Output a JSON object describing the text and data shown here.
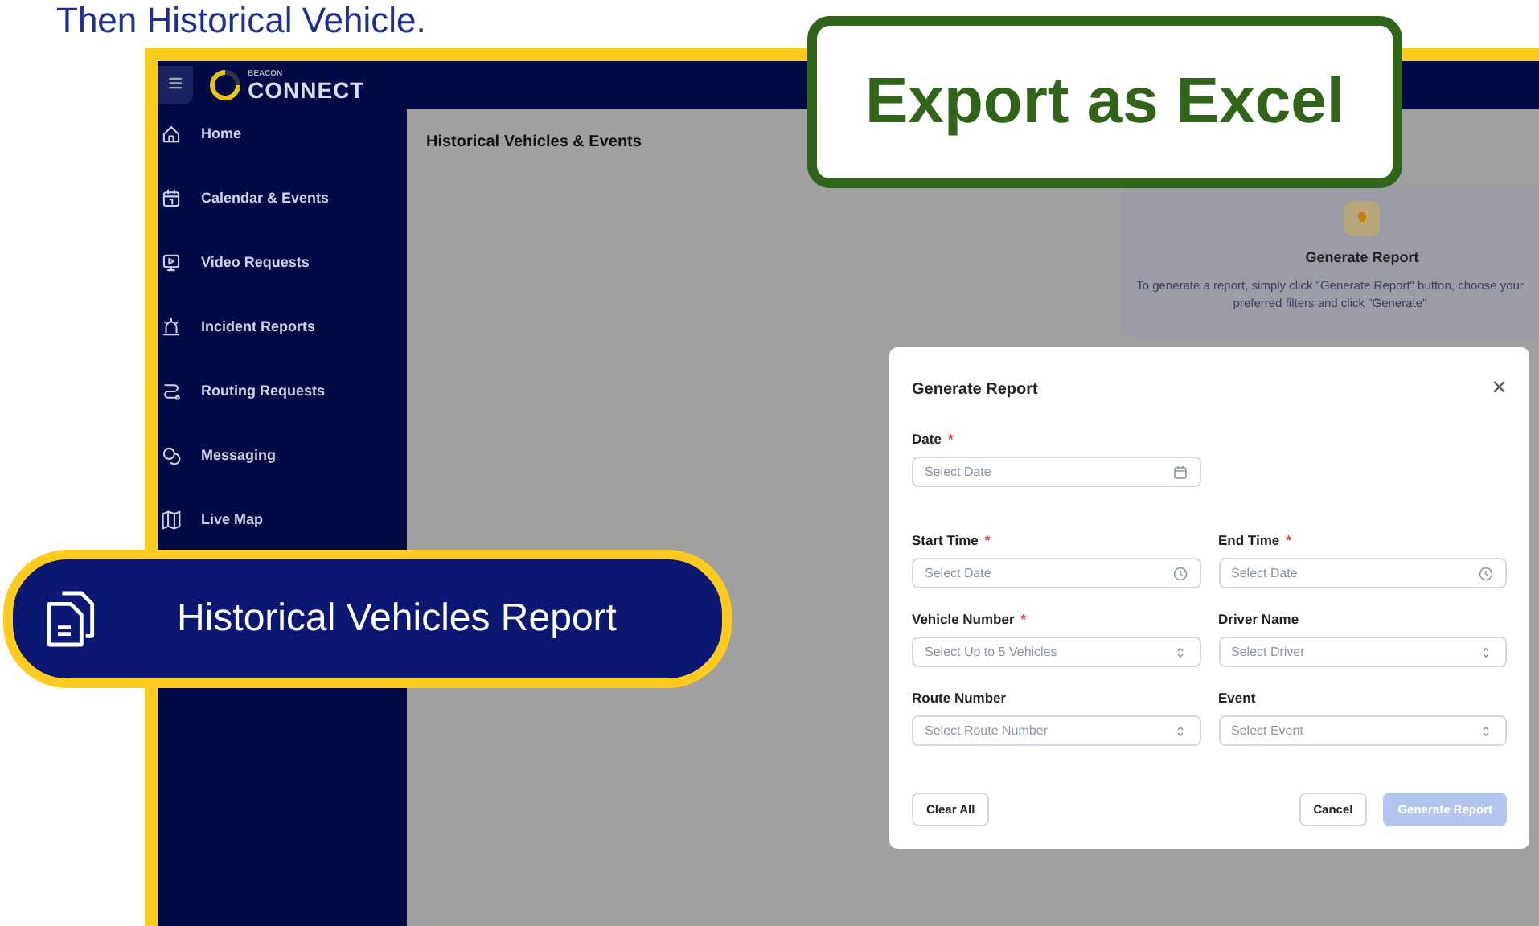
{
  "slide_heading": "Then Historical Vehicle.",
  "app": {
    "menu_glyph": "≡",
    "logo_small": "BEACON",
    "logo": "CONNECT",
    "sidebar": {
      "items": [
        {
          "label": "Home"
        },
        {
          "label": "Calendar & Events"
        },
        {
          "label": "Video Requests"
        },
        {
          "label": "Incident Reports"
        },
        {
          "label": "Routing Requests"
        },
        {
          "label": "Messaging"
        },
        {
          "label": "Live Map"
        }
      ]
    },
    "page_title": "Historical Vehicles & Events",
    "info_card": {
      "title": "Generate Report",
      "text": "To generate a report, simply click \"Generate Report\" button, choose your preferred filters and click \"Generate\""
    },
    "dialog": {
      "title": "Generate Report",
      "close": "×",
      "required_mark": "*",
      "fields": [
        {
          "label": "Date",
          "required": true,
          "kind": "date",
          "placeholder": "Select Date"
        },
        {
          "label": "Start Time",
          "required": true,
          "kind": "time",
          "placeholder": "Select Date"
        },
        {
          "label": "End Time",
          "required": true,
          "kind": "time",
          "placeholder": "Select Date"
        },
        {
          "label": "Vehicle Number",
          "required": true,
          "kind": "select",
          "placeholder": "Select Up to 5 Vehicles"
        },
        {
          "label": "Driver Name",
          "required": false,
          "kind": "select",
          "placeholder": "Select Driver"
        },
        {
          "label": "Route Number",
          "required": false,
          "kind": "select",
          "placeholder": "Select Route Number"
        },
        {
          "label": "Event",
          "required": false,
          "kind": "select",
          "placeholder": "Select Event"
        }
      ],
      "buttons": [
        {
          "label": "Clear All",
          "kind": "secondary",
          "disabled": false
        },
        {
          "label": "Cancel",
          "kind": "secondary",
          "disabled": false
        },
        {
          "label": "Generate Report",
          "kind": "primary",
          "disabled": true
        }
      ]
    }
  },
  "callouts": [
    {
      "kind": "export",
      "label": "Export as Excel"
    },
    {
      "kind": "menu",
      "label": "Historical Vehicles Report"
    }
  ]
}
